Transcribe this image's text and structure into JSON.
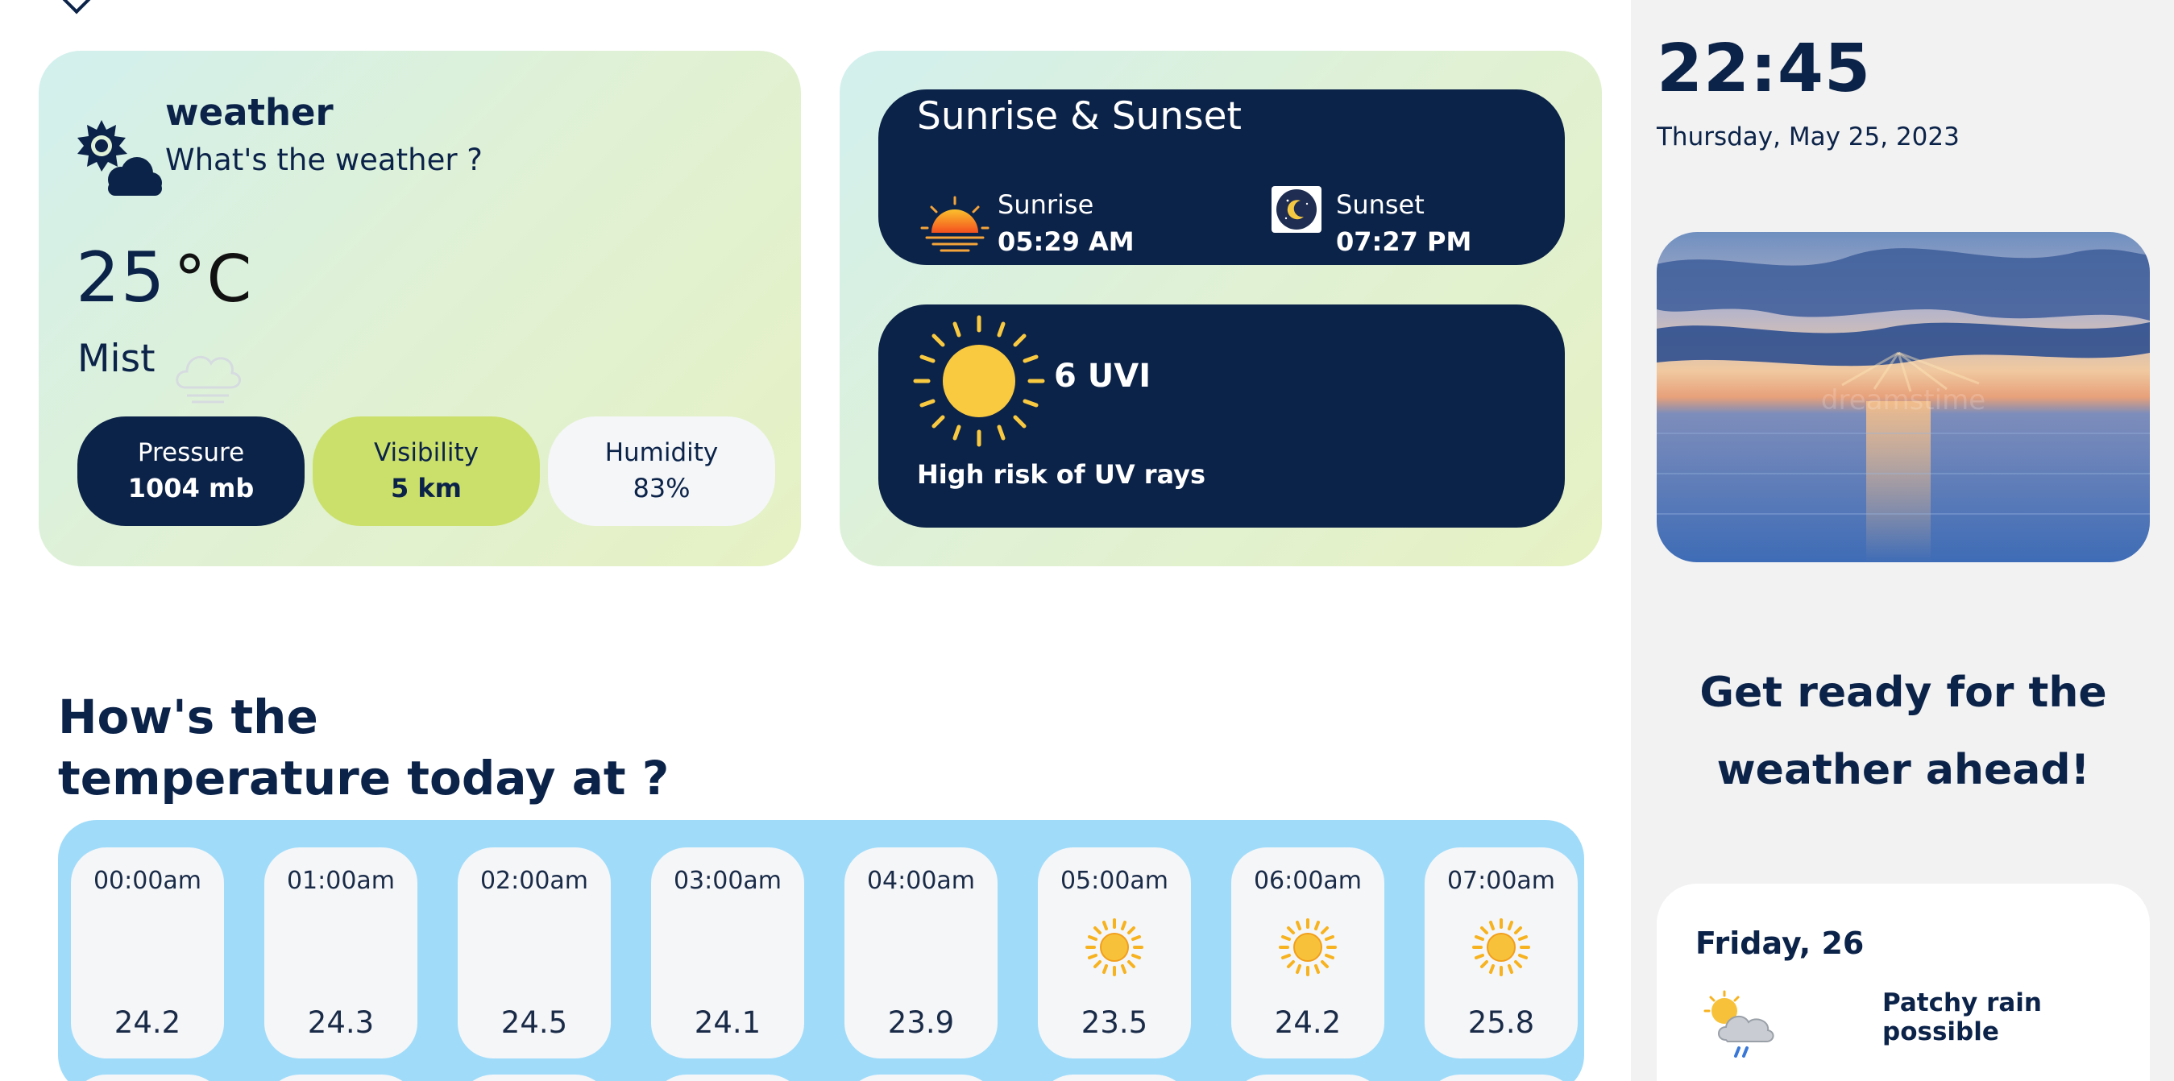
{
  "weather": {
    "title": "weather",
    "subtitle": "What's the weather ?",
    "temperature": "25",
    "unit": "°C",
    "condition": "Mist",
    "pressure": {
      "label": "Pressure",
      "value": "1004 mb"
    },
    "visibility": {
      "label": "Visibility",
      "value": "5 km"
    },
    "humidity": {
      "label": "Humidity",
      "value": "83%"
    }
  },
  "sun": {
    "title": "Sunrise & Sunset",
    "sunrise_label": "Sunrise",
    "sunrise_time": "05:29 AM",
    "sunset_label": "Sunset",
    "sunset_time": "07:27 PM"
  },
  "uv": {
    "value": "6 UVI",
    "description": "High risk of UV rays"
  },
  "hourly_heading": {
    "line1": "How's the",
    "line2": "temperature today at ?"
  },
  "hourly": [
    {
      "time": "00:00am",
      "icon": "moon-icon",
      "temp": "24.2"
    },
    {
      "time": "01:00am",
      "icon": "moon-icon",
      "temp": "24.3"
    },
    {
      "time": "02:00am",
      "icon": "moon-icon",
      "temp": "24.5"
    },
    {
      "time": "03:00am",
      "icon": "moon-icon",
      "temp": "24.1"
    },
    {
      "time": "04:00am",
      "icon": "moon-icon",
      "temp": "23.9"
    },
    {
      "time": "05:00am",
      "icon": "sun-icon",
      "temp": "23.5"
    },
    {
      "time": "06:00am",
      "icon": "sun-icon",
      "temp": "24.2"
    },
    {
      "time": "07:00am",
      "icon": "sun-icon",
      "temp": "25.8"
    }
  ],
  "sidebar": {
    "time": "22:45",
    "date": "Thursday, May 25, 2023",
    "photo_watermark": "dreamstime",
    "tagline_line1": "Get ready for the",
    "tagline_line2": "weather ahead!",
    "forecast": {
      "day": "Friday, 26",
      "icon": "rain-cloud-icon",
      "description": "Patchy rain possible"
    }
  },
  "colors": {
    "navy": "#0c2349",
    "lime": "#cbe06a",
    "sky": "#a0dcfa",
    "sun": "#f7c23a",
    "moon": "#2a6fe0"
  }
}
